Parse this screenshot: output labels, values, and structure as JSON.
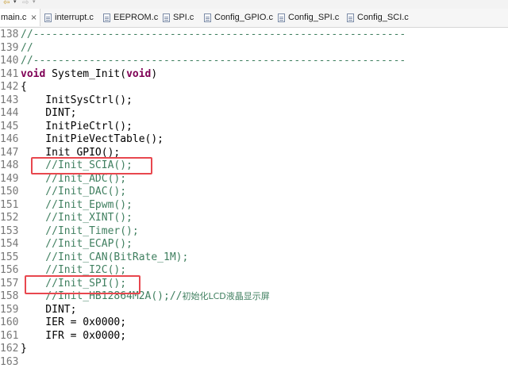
{
  "tabs": [
    {
      "label": "main.c",
      "close": "×"
    },
    {
      "label": "interrupt.c"
    },
    {
      "label": "EEPROM.c"
    },
    {
      "label": "SPI.c"
    },
    {
      "label": "Config_GPIO.c"
    },
    {
      "label": "Config_SPI.c"
    },
    {
      "label": "Config_SCI.c"
    }
  ],
  "editor": {
    "lines": [
      {
        "num": "138",
        "parts": [
          {
            "t": "//------------------------------------------------------------",
            "c": "cmt"
          }
        ]
      },
      {
        "num": "139",
        "parts": [
          {
            "t": "//",
            "c": "cmt"
          }
        ]
      },
      {
        "num": "140",
        "parts": [
          {
            "t": "//------------------------------------------------------------",
            "c": "cmt"
          }
        ]
      },
      {
        "num": "141",
        "parts": [
          {
            "t": "void",
            "c": "kw"
          },
          {
            "t": " System_Init(",
            "c": "code"
          },
          {
            "t": "void",
            "c": "kw"
          },
          {
            "t": ")",
            "c": "code"
          }
        ]
      },
      {
        "num": "142",
        "parts": [
          {
            "t": "{",
            "c": "code"
          }
        ]
      },
      {
        "num": "143",
        "parts": [
          {
            "t": "    InitSysCtrl();",
            "c": "code"
          }
        ]
      },
      {
        "num": "144",
        "parts": [
          {
            "t": "    DINT;",
            "c": "code"
          }
        ]
      },
      {
        "num": "145",
        "parts": [
          {
            "t": "    InitPieCtrl();",
            "c": "code"
          }
        ]
      },
      {
        "num": "146",
        "parts": [
          {
            "t": "    InitPieVectTable();",
            "c": "code"
          }
        ]
      },
      {
        "num": "147",
        "parts": [
          {
            "t": "    Init_GPIO();",
            "c": "code"
          }
        ]
      },
      {
        "num": "148",
        "parts": [
          {
            "t": "    //Init_SCIA();",
            "c": "cmt"
          }
        ]
      },
      {
        "num": "149",
        "parts": [
          {
            "t": "    //Init_ADC();",
            "c": "cmt"
          }
        ]
      },
      {
        "num": "150",
        "parts": [
          {
            "t": "    //Init_DAC();",
            "c": "cmt"
          }
        ]
      },
      {
        "num": "151",
        "parts": [
          {
            "t": "    //Init_Epwm();",
            "c": "cmt"
          }
        ]
      },
      {
        "num": "152",
        "parts": [
          {
            "t": "    //Init_XINT();",
            "c": "cmt"
          }
        ]
      },
      {
        "num": "153",
        "parts": [
          {
            "t": "    //Init_Timer();",
            "c": "cmt"
          }
        ]
      },
      {
        "num": "154",
        "parts": [
          {
            "t": "    //Init_ECAP();",
            "c": "cmt"
          }
        ]
      },
      {
        "num": "155",
        "parts": [
          {
            "t": "    //Init_CAN(BitRate_1M);",
            "c": "cmt"
          }
        ]
      },
      {
        "num": "156",
        "parts": [
          {
            "t": "    //Init_I2C();",
            "c": "cmt"
          }
        ]
      },
      {
        "num": "157",
        "parts": [
          {
            "t": "    //Init_SPI();",
            "c": "cmt"
          }
        ]
      },
      {
        "num": "158",
        "parts": [
          {
            "t": "    //Init_HB12864M2A();//",
            "c": "cmt"
          },
          {
            "t": "初始化LCD液晶显示屏",
            "c": "cmt cn"
          }
        ]
      },
      {
        "num": "159",
        "parts": [
          {
            "t": "    DINT;",
            "c": "code"
          }
        ]
      },
      {
        "num": "160",
        "parts": [
          {
            "t": "    IER = 0x0000;",
            "c": "code"
          }
        ]
      },
      {
        "num": "161",
        "parts": [
          {
            "t": "    IFR = 0x0000;",
            "c": "code"
          }
        ]
      },
      {
        "num": "162",
        "parts": [
          {
            "t": "}",
            "c": "code"
          }
        ]
      },
      {
        "num": "163",
        "parts": []
      }
    ]
  },
  "colors": {
    "comment": "#3f7f5f",
    "keyword": "#7f0055",
    "highlight_box": "#e8474e",
    "line_number": "#787878"
  },
  "icons": [
    "back-arrow-icon",
    "forward-arrow-icon",
    "c-file-icon",
    "close-icon"
  ]
}
